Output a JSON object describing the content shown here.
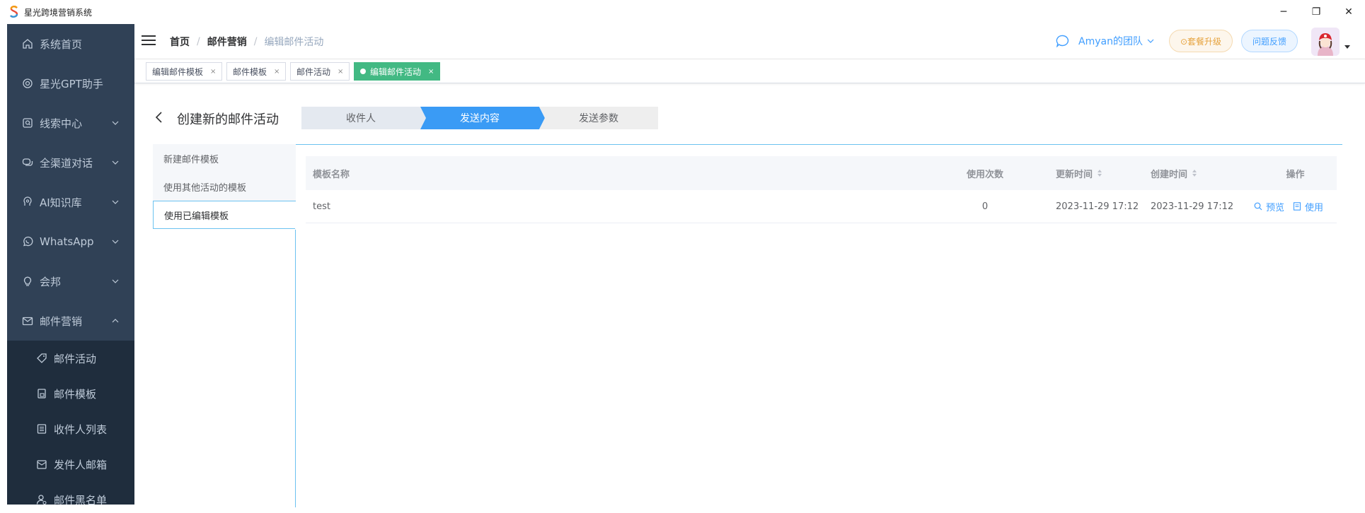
{
  "window": {
    "logo": "S",
    "title": "星光跨境营销系统",
    "controls": [
      "─",
      "❐",
      "✕"
    ]
  },
  "sidebar": {
    "items": [
      {
        "label": "系统首页",
        "icon": "home-icon"
      },
      {
        "label": "星光GPT助手",
        "icon": "gpt-icon"
      },
      {
        "label": "线索中心",
        "icon": "search-doc-icon",
        "expandable": true
      },
      {
        "label": "全渠道对话",
        "icon": "chat-bubbles-icon",
        "expandable": true
      },
      {
        "label": "AI知识库",
        "icon": "brain-icon",
        "expandable": true
      },
      {
        "label": "WhatsApp",
        "icon": "whatsapp-icon",
        "expandable": true
      },
      {
        "label": "会邦",
        "icon": "lightbulb-icon",
        "expandable": true
      },
      {
        "label": "邮件营销",
        "icon": "mail-icon",
        "expandable": true,
        "expanded": true
      }
    ],
    "subitems": [
      {
        "label": "邮件活动",
        "icon": "tag-icon"
      },
      {
        "label": "邮件模板",
        "icon": "template-icon"
      },
      {
        "label": "收件人列表",
        "icon": "list-icon"
      },
      {
        "label": "发件人邮箱",
        "icon": "inbox-icon"
      },
      {
        "label": "邮件黑名单",
        "icon": "user-block-icon"
      }
    ]
  },
  "navbar": {
    "breadcrumb": [
      "首页",
      "邮件营销",
      "编辑邮件活动"
    ],
    "team_label": "Amyan的团队",
    "upgrade_label": "⊙套餐升级",
    "feedback_label": "问题反馈"
  },
  "tags": [
    {
      "label": "编辑邮件模板",
      "close": "×"
    },
    {
      "label": "邮件模板",
      "close": "×"
    },
    {
      "label": "邮件活动",
      "close": "×"
    },
    {
      "label": "编辑邮件活动",
      "close": "×",
      "active": true
    }
  ],
  "page": {
    "title": "创建新的邮件活动",
    "steps": [
      "收件人",
      "发送内容",
      "发送参数"
    ],
    "active_step": 1
  },
  "template_tabs": [
    "新建邮件模板",
    "使用其他活动的模板",
    "使用已编辑模板"
  ],
  "active_template_tab": 2,
  "table": {
    "headers": {
      "name": "模板名称",
      "count": "使用次数",
      "updated": "更新时间",
      "created": "创建时间",
      "ops": "操作"
    },
    "rows": [
      {
        "name": "test",
        "count": "0",
        "updated": "2023-11-29 17:12",
        "created": "2023-11-29 17:12",
        "preview": "预览",
        "use": "使用"
      }
    ]
  },
  "colors": {
    "sidebar_bg": "#304156",
    "submenu_bg": "#1f2d3d",
    "accent": "#409eff",
    "tag_active": "#42b983",
    "step_active": "#3a9bf5"
  }
}
